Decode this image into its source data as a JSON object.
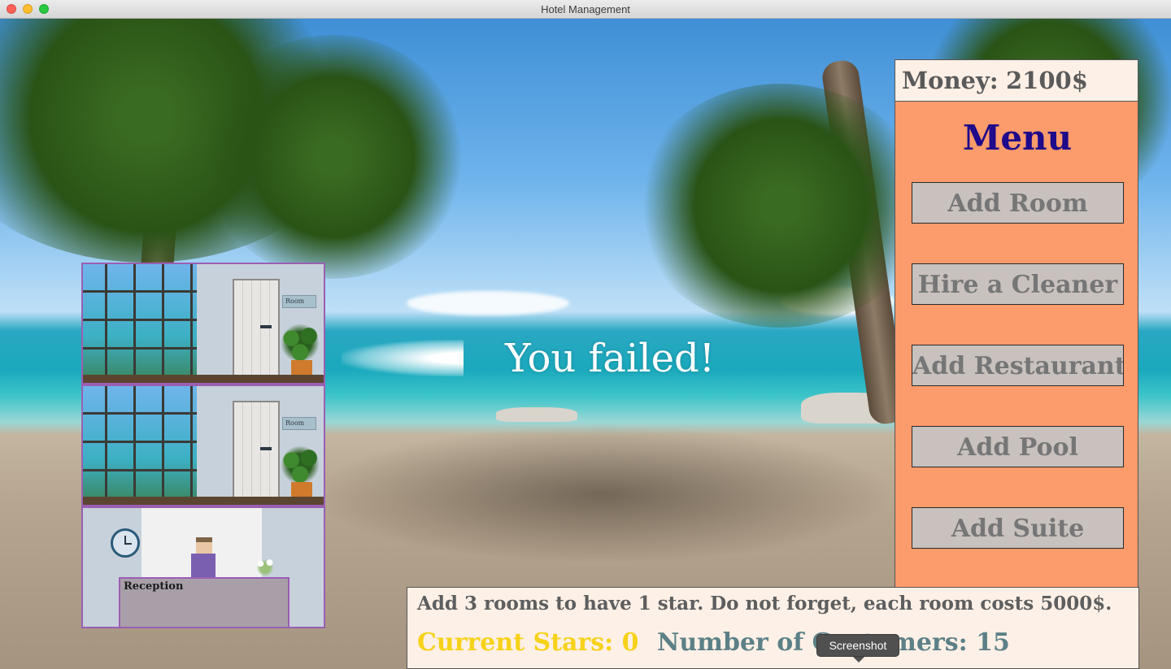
{
  "window": {
    "title": "Hotel Management",
    "controls": [
      "close-button",
      "minimize-button",
      "zoom-button"
    ]
  },
  "game": {
    "status_message": "You failed!",
    "money": {
      "label": "Money:",
      "value": "2100$"
    },
    "menu": {
      "title": "Menu",
      "buttons": [
        {
          "label": "Add Room"
        },
        {
          "label": "Hire a Cleaner"
        },
        {
          "label": "Add Restaurant"
        },
        {
          "label": "Add Pool"
        },
        {
          "label": "Add Suite"
        }
      ]
    },
    "hotel": {
      "room_sign": "Room",
      "reception_label": "Reception"
    },
    "info": {
      "hint": "Add 3 rooms to have 1 star. Do not forget, each room costs 5000$.",
      "current_stars": "Current Stars: 0",
      "customers": "Number of Customers: 15"
    },
    "tooltip": "Screenshot"
  },
  "colors": {
    "menu_bg": "#fc9b6b",
    "menu_title": "#1e0a8a",
    "stars_text": "#f7d21a",
    "customers_text": "#5c8087",
    "panel_bg": "#fdf0e6"
  }
}
